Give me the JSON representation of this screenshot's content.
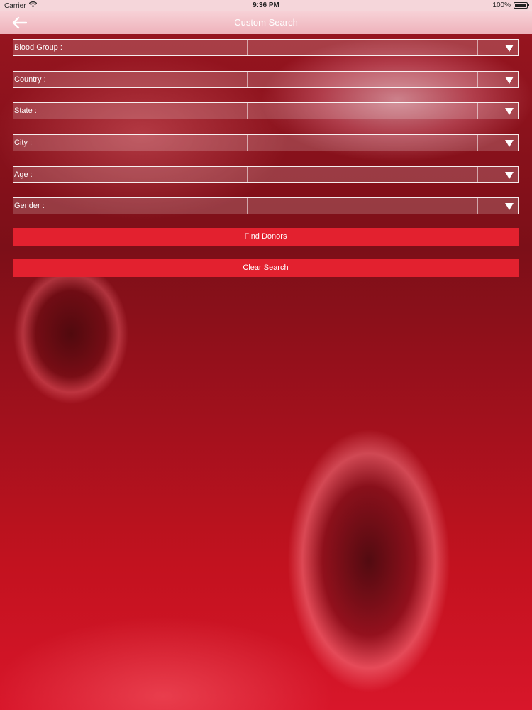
{
  "status_bar": {
    "carrier": "Carrier",
    "time": "9:36 PM",
    "battery": "100%"
  },
  "nav": {
    "title": "Custom Search"
  },
  "fields": [
    {
      "label": "Blood Group :",
      "value": ""
    },
    {
      "label": "Country :",
      "value": ""
    },
    {
      "label": "State :",
      "value": ""
    },
    {
      "label": "City :",
      "value": ""
    },
    {
      "label": "Age :",
      "value": ""
    },
    {
      "label": "Gender :",
      "value": ""
    }
  ],
  "buttons": {
    "find_donors": "Find Donors",
    "clear_search": "Clear Search"
  },
  "colors": {
    "button": "#e3212f",
    "nav_bg": "#fad0d6"
  },
  "icons": {
    "back": "arrow-left-icon",
    "dropdown": "triangle-down-icon",
    "wifi": "wifi-icon",
    "battery": "battery-icon"
  }
}
